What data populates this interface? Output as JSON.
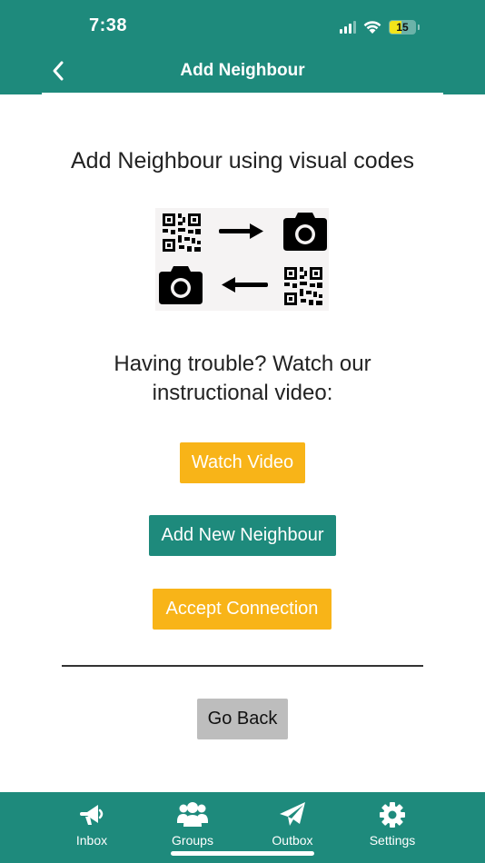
{
  "status_bar": {
    "time": "7:38",
    "battery": "15"
  },
  "nav": {
    "title": "Add Neighbour",
    "back_icon": "chevron-left-icon"
  },
  "main": {
    "headline": "Add Neighbour using visual codes",
    "trouble_line1": "Having trouble? Watch our",
    "trouble_line2": "instructional video:",
    "buttons": {
      "watch_video": "Watch Video",
      "add_new_neighbour": "Add New Neighbour",
      "accept_connection": "Accept Connection",
      "go_back": "Go Back"
    }
  },
  "tabs": [
    {
      "label": "Inbox",
      "icon": "megaphone-icon"
    },
    {
      "label": "Groups",
      "icon": "users-icon"
    },
    {
      "label": "Outbox",
      "icon": "paper-plane-icon"
    },
    {
      "label": "Settings",
      "icon": "gear-icon"
    }
  ],
  "colors": {
    "primary": "#1e8a7c",
    "accent": "#f8b418",
    "neutral": "#bdbdbd"
  }
}
